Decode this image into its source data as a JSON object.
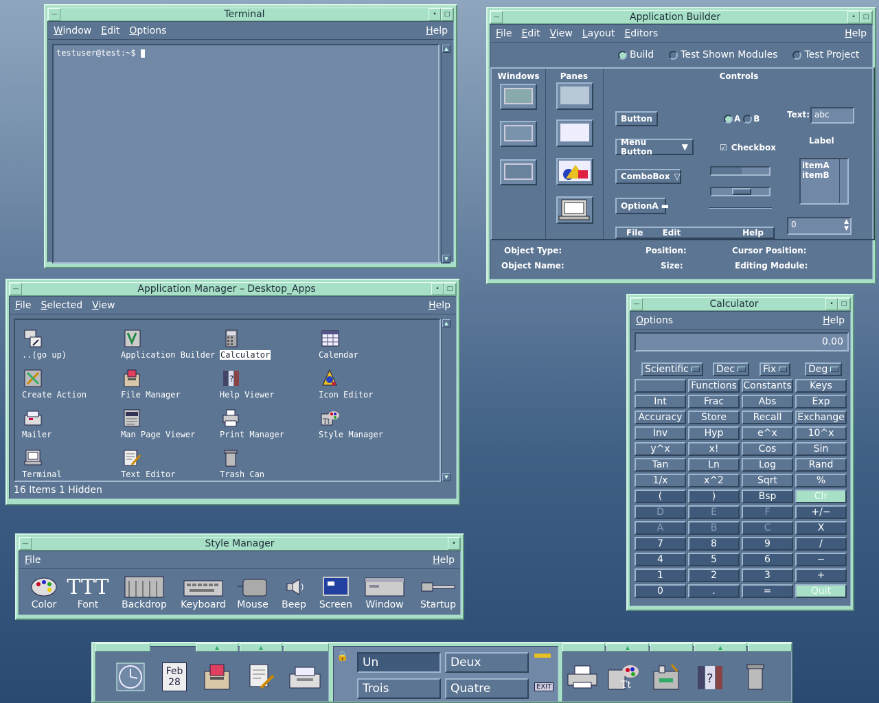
{
  "terminal": {
    "title": "Terminal",
    "menu": [
      "Window",
      "Edit",
      "Options"
    ],
    "help": "Help",
    "prompt": "testuser@test:~$ "
  },
  "app_builder": {
    "title": "Application Builder",
    "menu": [
      "File",
      "Edit",
      "View",
      "Layout",
      "Editors"
    ],
    "help": "Help",
    "modes": [
      "Build",
      "Test Shown Modules",
      "Test Project"
    ],
    "palette_headers": [
      "Windows",
      "Panes",
      "Controls"
    ],
    "controls": {
      "button": "Button",
      "menu_button": "Menu Button",
      "combobox": "ComboBox",
      "option": "OptionA",
      "radio_a": "A",
      "radio_b": "B",
      "checkbox": "Checkbox",
      "text_label": "Text:",
      "text_value": "abc",
      "label": "Label",
      "list_items": [
        "itemA",
        "itemB"
      ],
      "spin_value": "0",
      "menubar_items": [
        "File",
        "Edit",
        "Help"
      ]
    },
    "status": {
      "object_type": "Object Type:",
      "object_name": "Object Name:",
      "position": "Position:",
      "size": "Size:",
      "cursor_position": "Cursor Position:",
      "editing_module": "Editing Module:"
    }
  },
  "app_manager": {
    "title": "Application Manager – Desktop_Apps",
    "menu": [
      "File",
      "Selected",
      "View"
    ],
    "help": "Help",
    "icons": [
      {
        "name": "..(go up)",
        "icon": "go-up-icon"
      },
      {
        "name": "Application Builder",
        "icon": "app-builder-icon"
      },
      {
        "name": "Calculator",
        "icon": "calculator-icon",
        "selected": true
      },
      {
        "name": "Calendar",
        "icon": "calendar-icon"
      },
      {
        "name": "Create Action",
        "icon": "create-action-icon"
      },
      {
        "name": "File Manager",
        "icon": "file-manager-icon"
      },
      {
        "name": "Help Viewer",
        "icon": "help-viewer-icon"
      },
      {
        "name": "Icon Editor",
        "icon": "icon-editor-icon"
      },
      {
        "name": "Mailer",
        "icon": "mailer-icon"
      },
      {
        "name": "Man Page Viewer",
        "icon": "man-page-icon"
      },
      {
        "name": "Print Manager",
        "icon": "print-manager-icon"
      },
      {
        "name": "Style Manager",
        "icon": "style-manager-icon"
      },
      {
        "name": "Terminal",
        "icon": "terminal-icon"
      },
      {
        "name": "Text Editor",
        "icon": "text-editor-icon"
      },
      {
        "name": "Trash Can",
        "icon": "trash-can-icon"
      }
    ],
    "status": "16 Items 1 Hidden"
  },
  "style_manager": {
    "title": "Style Manager",
    "menu": [
      "File"
    ],
    "help": "Help",
    "items": [
      "Color",
      "Font",
      "Backdrop",
      "Keyboard",
      "Mouse",
      "Beep",
      "Screen",
      "Window",
      "Startup"
    ]
  },
  "calculator": {
    "title": "Calculator",
    "menu": [
      "Options"
    ],
    "help": "Help",
    "display": "0.00",
    "mode": "Scientific",
    "base": "Dec",
    "notation": "Fix",
    "trig": "Deg",
    "rows": [
      [
        "",
        "Functions",
        "Constants",
        "Keys"
      ],
      [
        "Int",
        "Frac",
        "Abs",
        "Exp"
      ],
      [
        "Accuracy",
        "Store",
        "Recall",
        "Exchange"
      ],
      [
        "Inv",
        "Hyp",
        "e^x",
        "10^x"
      ],
      [
        "y^x",
        "x!",
        "Cos",
        "Sin"
      ],
      [
        "Tan",
        "Ln",
        "Log",
        "Rand"
      ],
      [
        "1/x",
        "x^2",
        "Sqrt",
        "%"
      ],
      [
        "(",
        ")",
        "Bsp",
        "Clr"
      ],
      [
        "D",
        "E",
        "F",
        "+/−"
      ],
      [
        "A",
        "B",
        "C",
        "X"
      ],
      [
        "7",
        "8",
        "9",
        "/"
      ],
      [
        "4",
        "5",
        "6",
        "−"
      ],
      [
        "1",
        "2",
        "3",
        "+"
      ],
      [
        "0",
        ".",
        "=",
        "Quit"
      ]
    ]
  },
  "front_panel": {
    "date_month": "Feb",
    "date_day": "28",
    "workspaces": [
      "Un",
      "Deux",
      "Trois",
      "Quatre"
    ],
    "exit": "EXIT"
  }
}
